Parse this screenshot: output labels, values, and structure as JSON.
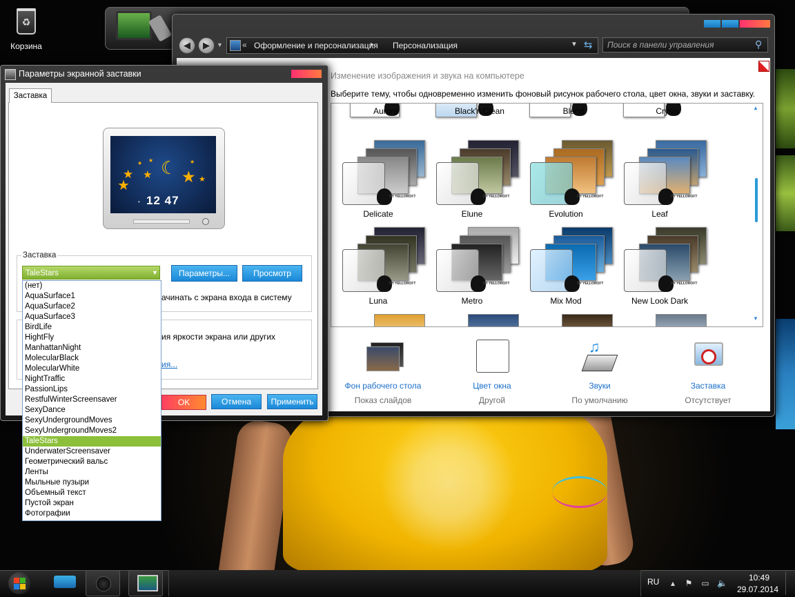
{
  "desktop": {
    "recycle_bin_label": "Корзина"
  },
  "control_panel": {
    "breadcrumb_chevron": "«",
    "breadcrumb": [
      "Оформление и персонализация",
      "Персонализация"
    ],
    "breadcrumb_separator": "▸",
    "search_placeholder": "Поиск в панели управления",
    "heading": "Изменение изображения и звука на компьютере",
    "subheading": "Выберите тему, чтобы одновременно изменить фоновый рисунок рабочего стола, цвет окна, звуки и заставку.",
    "themes_row1": [
      "Aurora",
      "Black'n'Clean",
      "Blend",
      "Crysis"
    ],
    "themes_row2": [
      "Delicate",
      "Elune",
      "Evolution",
      "Leaf"
    ],
    "themes_row3": [
      "Luna",
      "Metro",
      "Mix Mod",
      "New Look Dark"
    ],
    "theme_badge_text": "BY YELLOROFT",
    "customizations": [
      {
        "title": "Фон рабочего стола",
        "subtitle": "Показ слайдов",
        "icon": "wallpaper-stack-icon"
      },
      {
        "title": "Цвет окна",
        "subtitle": "Другой",
        "icon": "window-color-icon"
      },
      {
        "title": "Звуки",
        "subtitle": "По умолчанию",
        "icon": "sounds-icon"
      },
      {
        "title": "Заставка",
        "subtitle": "Отсутствует",
        "icon": "screensaver-none-icon"
      }
    ]
  },
  "screensaver_dialog": {
    "title": "Параметры экранной заставки",
    "tab_label": "Заставка",
    "preview_clock": "12 47",
    "group_label": "Заставка",
    "selected": "TaleStars",
    "params_button": "Параметры...",
    "preview_button": "Просмотр",
    "resume_text_visible": "ачинать с экрана входа в систему",
    "power_text_visible": "ия яркости экрана или других",
    "power_link_visible": "ия...",
    "ok_button": "OK",
    "cancel_button": "Отмена",
    "apply_button": "Применить",
    "options": [
      "(нет)",
      "AquaSurface1",
      "AquaSurface2",
      "AquaSurface3",
      "BirdLife",
      "HightFly",
      "ManhattanNight",
      "MolecularBlack",
      "MolecularWhite",
      "NightTraffic",
      "PassionLips",
      "RestfulWinterScreensaver",
      "SexyDance",
      "SexyUndergroundMoves",
      "SexyUndergroundMoves2",
      "TaleStars",
      "UnderwaterScreensaver",
      "Геометрический вальс",
      "Ленты",
      "Мыльные пузыри",
      "Объемный текст",
      "Пустой экран",
      "Фотографии"
    ]
  },
  "taskbar": {
    "language": "RU",
    "time": "10:49",
    "date": "29.07.2014"
  },
  "colors": {
    "accent_green": "#8cbf3a",
    "accent_blue": "#1a88d8",
    "close_red": "#ff3070",
    "link_blue": "#1a6ec8"
  }
}
